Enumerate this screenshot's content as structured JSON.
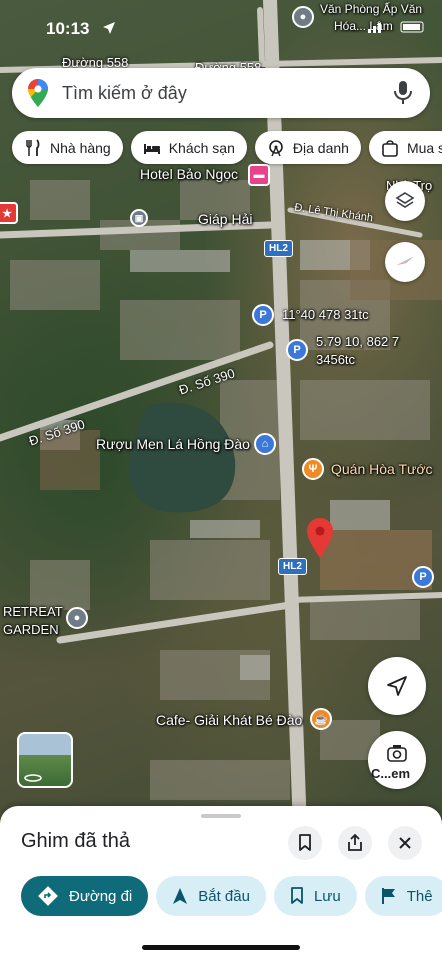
{
  "status_bar": {
    "time": "10:13"
  },
  "search": {
    "placeholder": "Tìm kiếm ở đây"
  },
  "chips": [
    {
      "label": "Nhà hàng",
      "icon": "fork-knife-icon"
    },
    {
      "label": "Khách sạn",
      "icon": "bed-icon"
    },
    {
      "label": "Địa danh",
      "icon": "ferris-wheel-icon"
    },
    {
      "label": "Mua s",
      "icon": "shopping-bag-icon"
    }
  ],
  "map": {
    "labels": {
      "van_phong": "Văn Phòng Ấp Văn",
      "van_phong_2": "Hóa... Lâm",
      "duong_558_a": "Đường 558",
      "duong_558_b": "Đường 558",
      "hotel": "Hotel Bảo Ngọc",
      "giap_hai": "Giáp Hải",
      "le_thi_khanh": "Đ. Lê Thị Khánh",
      "nhi_tro": "Nhà Trọ",
      "coord_1": "11°40 478 31tc",
      "coord_2": "5.79 10, 862 7",
      "coord_3": "3456tc",
      "so_390_a": "Đ. Số 390",
      "so_390_b": "Đ. Số 390",
      "ruou_men": "Rượu Men Lá Hồng Đào",
      "quan_hoa": "Quán Hòa Tước",
      "retreat": "RETREAT",
      "garden": "GARDEN",
      "cafe": "Cafe- Giải Khát Bé Đào",
      "shield_1": "HL2",
      "shield_2": "HL2",
      "cam_label": "C...em"
    }
  },
  "sheet": {
    "title": "Ghim đã thả",
    "actions": [
      {
        "label": "Đường đi",
        "icon": "directions-icon"
      },
      {
        "label": "Bắt đầu",
        "icon": "navigation-arrow-icon"
      },
      {
        "label": "Lưu",
        "icon": "bookmark-icon"
      },
      {
        "label": "Thê",
        "icon": "flag-icon"
      }
    ]
  },
  "colors": {
    "accent": "#0f6b7a",
    "pin_red": "#e53935",
    "chip_bg": "#ffffff"
  }
}
